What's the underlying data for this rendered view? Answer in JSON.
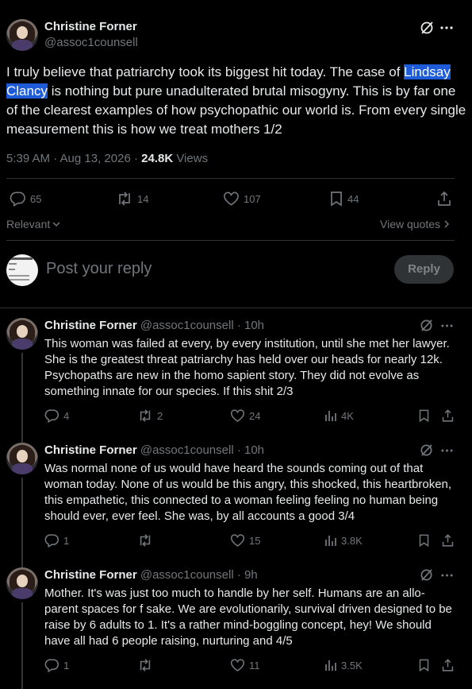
{
  "main_tweet": {
    "author_name": "Christine Forner",
    "handle": "@assoc1counsell",
    "text_before": "I truly believe that patriarchy took its biggest hit today. The case of ",
    "highlight": "Lindsay Clancy",
    "text_after": " is nothing but pure unadulterated brutal misogyny. This is by far one of the clearest examples of how psychopathic our world is. From every single measurement this is how we treat mothers 1/2",
    "timestamp": "5:39 AM · Aug 13, 2026 · ",
    "views_count": "24.8K",
    "views_label": " Views",
    "replies": "65",
    "reposts": "14",
    "likes": "107",
    "bookmarks": "44"
  },
  "sort": {
    "label": "Relevant",
    "view_quotes": "View quotes"
  },
  "composer": {
    "placeholder": "Post your reply",
    "reply_button": "Reply"
  },
  "replies": [
    {
      "author_name": "Christine Forner",
      "handle": "@assoc1counsell",
      "time": "10h",
      "text": "This woman was failed at every, by every institution, until she met her lawyer.  She is the greatest threat patriarchy has held over our heads for nearly 12k. Psychopaths are new in the homo sapient story. They did not evolve as something innate for our species. If this shit 2/3",
      "replies": "4",
      "reposts": "2",
      "likes": "24",
      "views": "4K"
    },
    {
      "author_name": "Christine Forner",
      "handle": "@assoc1counsell",
      "time": "10h",
      "text": "Was normal none of us would have heard the sounds coming out of that woman today. None of us would be this angry, this shocked, this heartbroken, this empathetic, this connected to a woman feeling feeling no human being should ever, ever feel. She was, by all accounts a good 3/4",
      "replies": "1",
      "reposts": "",
      "likes": "15",
      "views": "3.8K"
    },
    {
      "author_name": "Christine Forner",
      "handle": "@assoc1counsell",
      "time": "9h",
      "text": "Mother. It's was just too much to handle by her self. Humans are an allo-parent spaces for f sake. We are evolutionarily, survival driven designed to be raise by 6 adults to 1. It's a rather mind-boggling concept, hey! We should have all had 6 people raising, nurturing and 4/5",
      "replies": "1",
      "reposts": "",
      "likes": "11",
      "views": "3.5K"
    }
  ],
  "separator": " · ",
  "colors": {
    "accent": "#1d9bf0",
    "highlight_bg": "#1d5bd8",
    "muted": "#71767b",
    "reply_button_bg": "#303336"
  }
}
